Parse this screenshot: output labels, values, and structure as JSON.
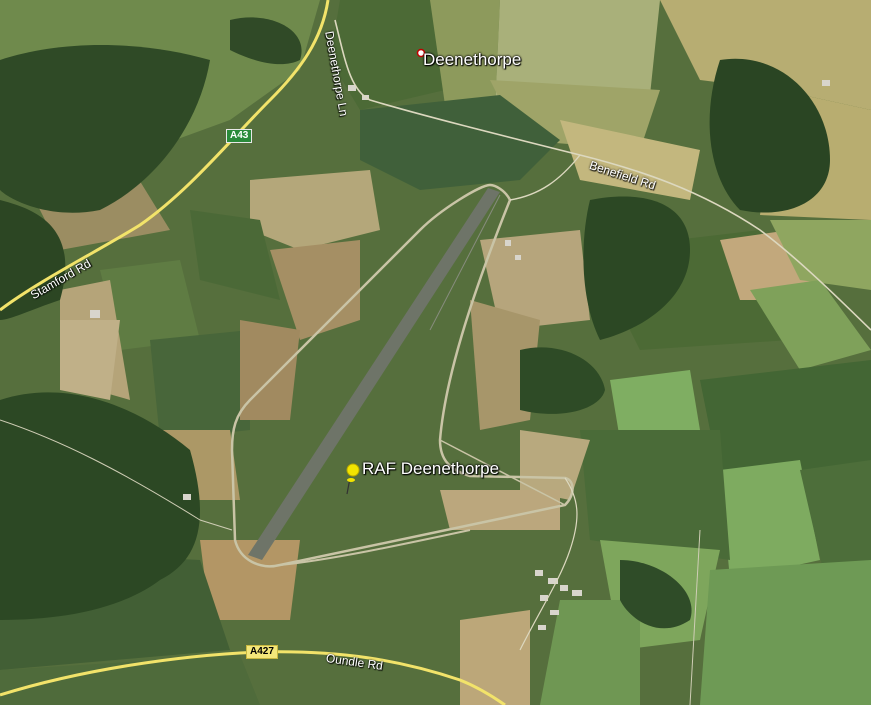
{
  "map": {
    "places": [
      {
        "name": "Deenethorpe"
      },
      {
        "name": "RAF Deenethorpe"
      }
    ],
    "roads": {
      "stamford": "Stamford Rd",
      "deenethorpe_ln": "Deenethorpe Ln",
      "benefield": "Benefield Rd",
      "oundle": "Oundle Rd",
      "a43": "A43",
      "a427": "A427"
    },
    "colors": {
      "field_dark": "#3f5a2e",
      "field_mid": "#5c7a44",
      "field_light": "#7b9a58",
      "field_tan": "#a99a6a",
      "forest": "#2b4424",
      "runway": "#6f7468",
      "main_road": "#f2e36a",
      "minor_road": "#e3e0c8",
      "pin": "#f2e400"
    },
    "icons": {
      "place_dot": "red-dot-icon",
      "pin": "yellow-pushpin-icon"
    }
  }
}
